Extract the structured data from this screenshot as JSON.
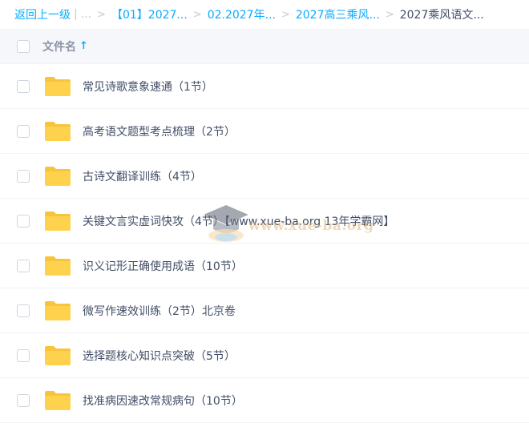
{
  "breadcrumb": {
    "back": "返回上一级",
    "ellipsis": "...",
    "items": [
      "【01】2027...",
      "02.2027年...",
      "2027高三乘风..."
    ],
    "current": "2027乘风语文..."
  },
  "header": {
    "name_label": "文件名",
    "sort_icon": "↑"
  },
  "files": [
    {
      "name": "常见诗歌意象速通（1节）",
      "icon": "folder-icon"
    },
    {
      "name": "高考语文题型考点梳理（2节）",
      "icon": "folder-icon"
    },
    {
      "name": "古诗文翻译训练（4节）",
      "icon": "folder-icon"
    },
    {
      "name": "关键文言实虚词快攻（4节）【www.xue-ba.org 13年学霸网】",
      "icon": "folder-icon"
    },
    {
      "name": "识义记形正确使用成语（10节）",
      "icon": "folder-icon"
    },
    {
      "name": "微写作速效训练（2节）北京卷",
      "icon": "folder-icon"
    },
    {
      "name": "选择题核心知识点突破（5节）",
      "icon": "folder-icon"
    },
    {
      "name": "找准病因速改常规病句（10节）",
      "icon": "folder-icon"
    }
  ],
  "watermark": {
    "text": "www.xue-ba.org"
  },
  "colors": {
    "link": "#09aaff",
    "folder": "#ffd24d",
    "folder_dark": "#f7c43c",
    "header_bg": "#f5f7fb",
    "text": "#424e67"
  }
}
